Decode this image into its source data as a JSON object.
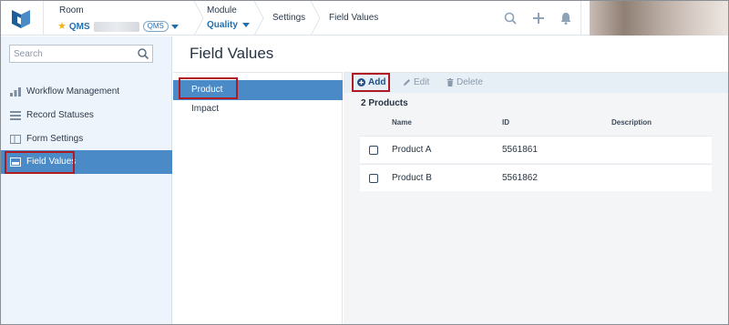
{
  "header": {
    "room_label": "Room",
    "room_name": "QMS",
    "room_badge": "QMS",
    "module_label": "Module",
    "module_name": "Quality",
    "nav": [
      "Settings",
      "Field Values"
    ]
  },
  "sidebar": {
    "search_placeholder": "Search",
    "items": [
      {
        "label": "Workflow Management",
        "icon": "workflow-icon"
      },
      {
        "label": "Record Statuses",
        "icon": "record-statuses-icon"
      },
      {
        "label": "Form Settings",
        "icon": "form-settings-icon"
      },
      {
        "label": "Field Values",
        "icon": "field-values-icon"
      }
    ]
  },
  "page": {
    "title": "Field Values"
  },
  "value_list": [
    "Product",
    "Impact"
  ],
  "toolbar": {
    "add": "Add",
    "edit": "Edit",
    "delete": "Delete"
  },
  "table": {
    "count_label": "2 Products",
    "columns": [
      "Name",
      "ID",
      "Description"
    ],
    "rows": [
      {
        "name": "Product A",
        "id": "5561861",
        "description": ""
      },
      {
        "name": "Product B",
        "id": "5561862",
        "description": ""
      }
    ]
  },
  "colors": {
    "accent": "#1f6fb0",
    "active_bg": "#4a8ac6",
    "highlight": "#b01b23",
    "star": "#f2b31b"
  }
}
